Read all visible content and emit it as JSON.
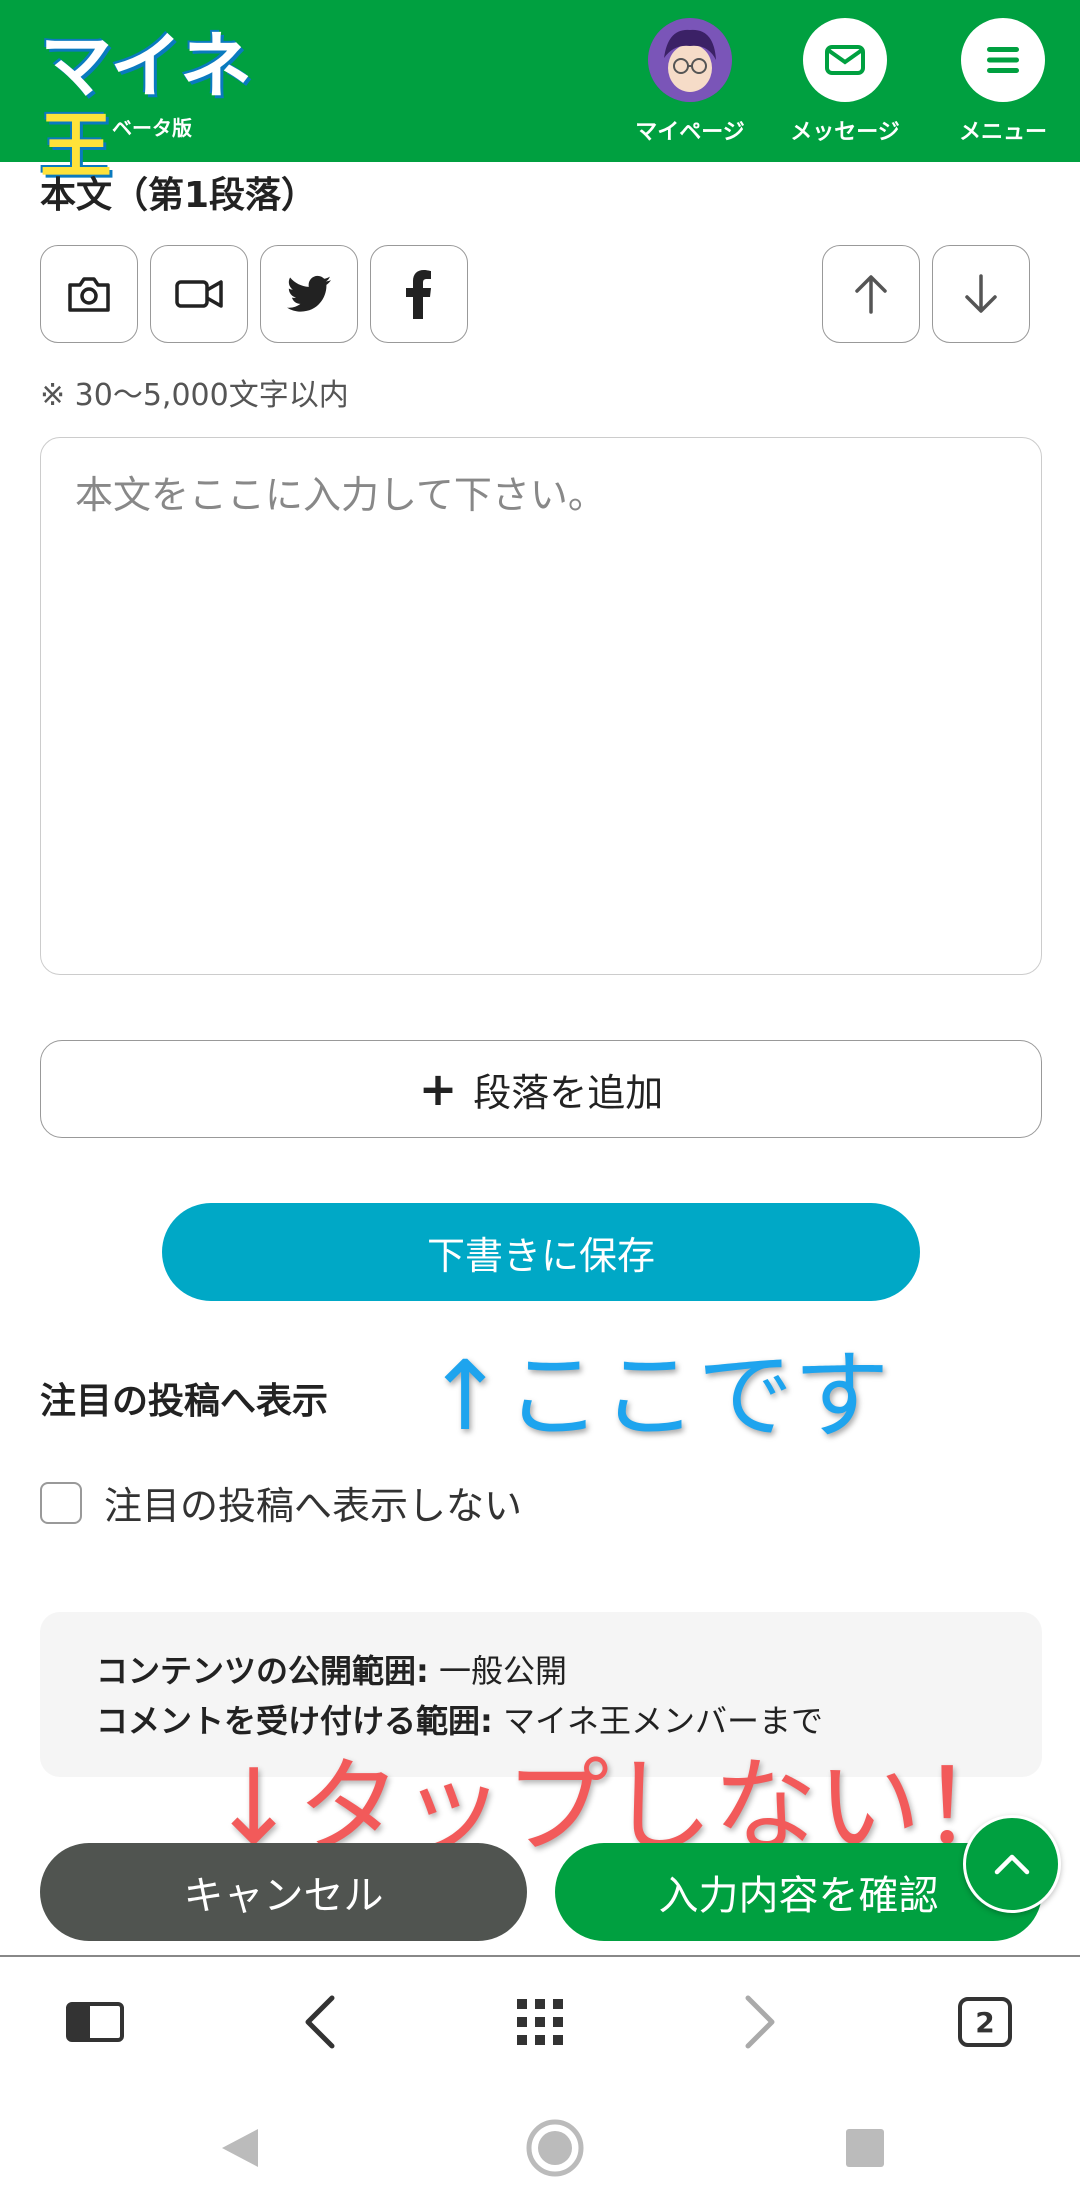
{
  "header": {
    "logo_text_main": "マイネ",
    "logo_text_accent": "王",
    "logo_sub": "ベータ版",
    "nav": [
      {
        "label": "マイページ"
      },
      {
        "label": "メッセージ"
      },
      {
        "label": "メニュー"
      }
    ]
  },
  "section": {
    "title": "本文（第1段落）",
    "note": "※ 30〜5,000文字以内",
    "textarea_placeholder": "本文をここに入力して下さい。",
    "add_paragraph": "段落を追加",
    "save_draft": "下書きに保存"
  },
  "featured": {
    "title": "注目の投稿へ表示",
    "checkbox_label": "注目の投稿へ表示しない",
    "checked": false
  },
  "info": {
    "scope_label": "コンテンツの公開範囲:",
    "scope_value": "一般公開",
    "comment_label": "コメントを受け付ける範囲:",
    "comment_value": "マイネ王メンバーまで"
  },
  "annotations": {
    "blue": "↑ここです",
    "red": "↓タップしない！"
  },
  "actions": {
    "cancel": "キャンセル",
    "confirm": "入力内容を確認"
  },
  "browser": {
    "tab_count": "2"
  },
  "colors": {
    "brand_green": "#00a040",
    "draft_blue": "#00a8c6",
    "cancel_gray": "#505450",
    "annotation_blue": "#1ea4ee",
    "annotation_red": "#f25a5a"
  }
}
